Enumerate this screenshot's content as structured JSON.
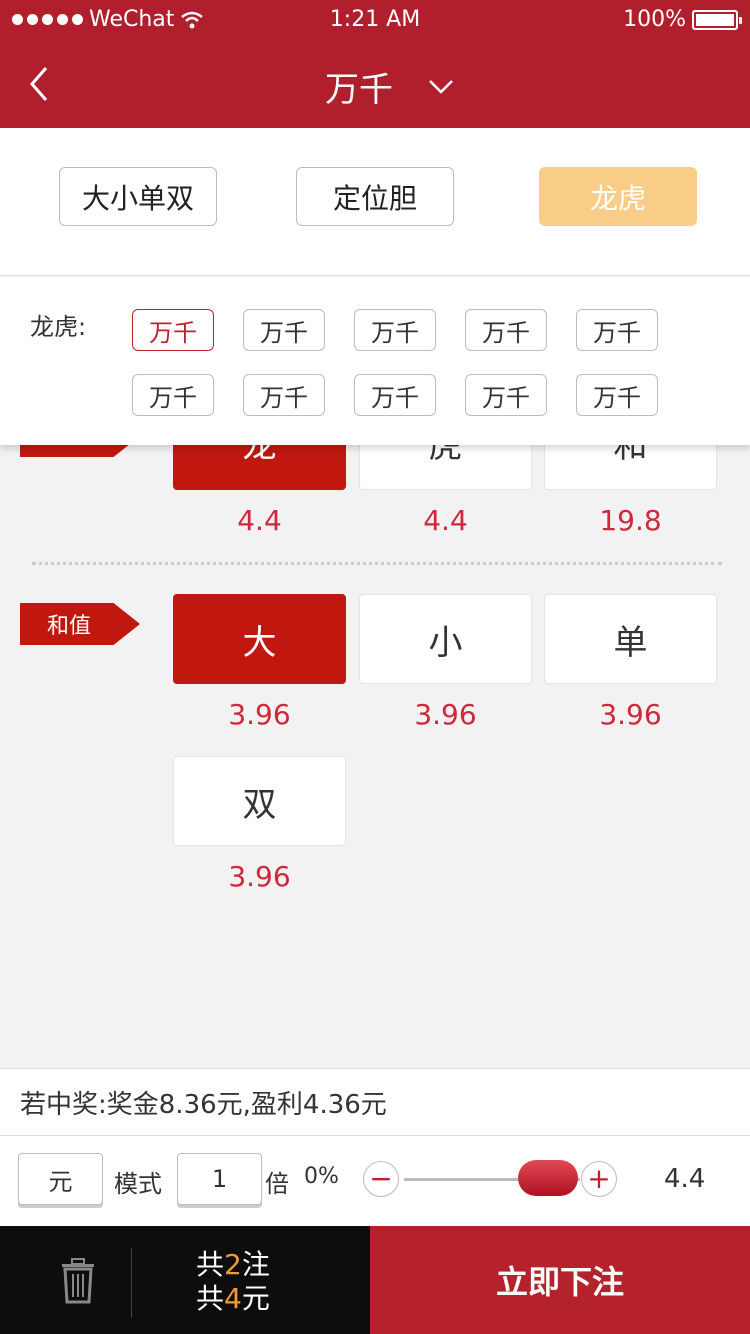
{
  "status_bar": {
    "carrier": "WeChat",
    "time": "1:21 AM",
    "battery": "100%"
  },
  "nav": {
    "title": "万千"
  },
  "tabs": [
    {
      "label": "大小单双",
      "active": false
    },
    {
      "label": "定位胆",
      "active": false
    },
    {
      "label": "龙虎",
      "active": true
    }
  ],
  "sub_panel": {
    "label": "龙虎:",
    "chips": [
      "万千",
      "万千",
      "万千",
      "万千",
      "万千",
      "万千",
      "万千",
      "万千",
      "万千",
      "万千"
    ],
    "active_index": 0
  },
  "section_dragon": {
    "options": [
      {
        "label": "龙",
        "odds": "4.4",
        "selected": true
      },
      {
        "label": "虎",
        "odds": "4.4",
        "selected": false
      },
      {
        "label": "和",
        "odds": "19.8",
        "selected": false
      }
    ]
  },
  "section_sum": {
    "tag": "和值",
    "options": [
      {
        "label": "大",
        "odds": "3.96",
        "selected": true
      },
      {
        "label": "小",
        "odds": "3.96",
        "selected": false
      },
      {
        "label": "单",
        "odds": "3.96",
        "selected": false
      },
      {
        "label": "双",
        "odds": "3.96",
        "selected": false
      }
    ]
  },
  "prize_info": "若中奖:奖金8.36元,盈利4.36元",
  "controls": {
    "unit": "元",
    "mode_label": "模式",
    "multiplier": "1",
    "multiplier_label": "倍",
    "rebate_percent": "0%",
    "minus": "−",
    "plus": "+",
    "slider_level": 1.0,
    "odds_value": "4.4"
  },
  "footer": {
    "count_prefix": "共",
    "count": "2",
    "count_suffix": "注",
    "amount_prefix": "共",
    "amount": "4",
    "amount_suffix": "元",
    "submit_label": "立即下注"
  },
  "colors": {
    "header": "#b11f2c",
    "accent": "#c0180f",
    "odds": "#d0283a",
    "active_tab": "#f9cd87",
    "highlight": "#f39a2f"
  }
}
